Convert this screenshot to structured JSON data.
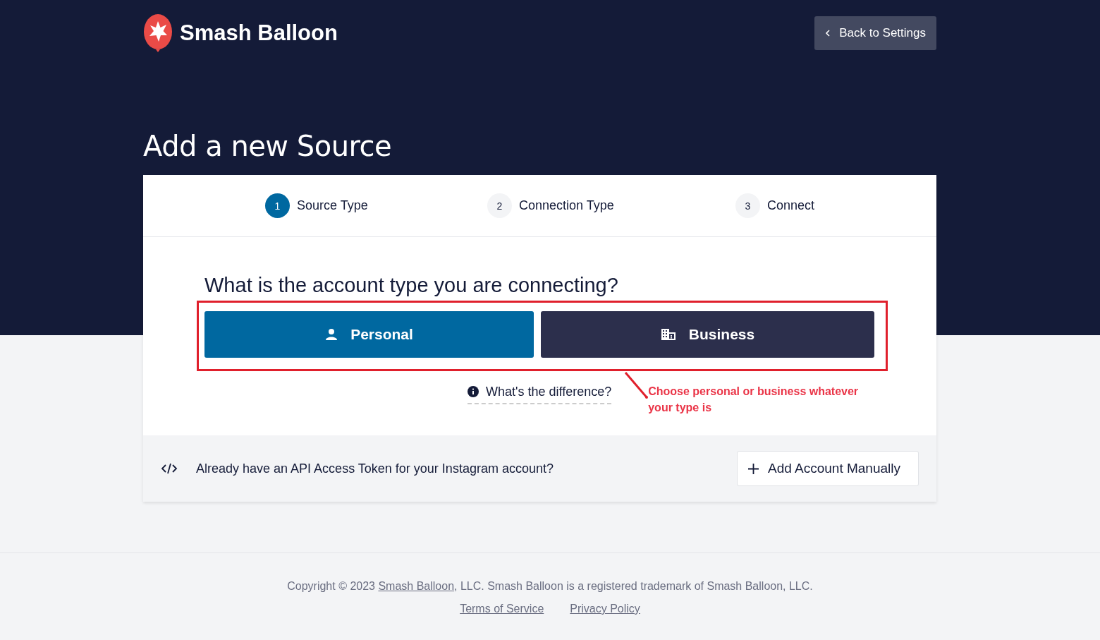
{
  "brand": {
    "name": "Smash Balloon"
  },
  "back_button": {
    "label": "Back to Settings"
  },
  "page_title": "Add a new Source",
  "steps": [
    {
      "number": "1",
      "label": "Source Type",
      "selected": true
    },
    {
      "number": "2",
      "label": "Connection Type",
      "selected": false
    },
    {
      "number": "3",
      "label": "Connect",
      "selected": false
    }
  ],
  "question": "What is the account type you are connecting?",
  "account_types": [
    {
      "kind": "personal",
      "label": "Personal"
    },
    {
      "kind": "business",
      "label": "Business"
    }
  ],
  "help_link": "What's the difference?",
  "annotation": {
    "text": "Choose personal or business whatever your type is"
  },
  "api_bar": {
    "text": "Already have an API Access Token for your Instagram account?",
    "button": "Add Account Manually"
  },
  "footer": {
    "copyright_before": "Copyright © 2023 ",
    "copyright_link": "Smash Balloon",
    "copyright_after": ", LLC. Smash Balloon is a registered trademark of Smash Balloon, LLC.",
    "links": [
      "Terms of Service",
      "Privacy Policy"
    ]
  }
}
